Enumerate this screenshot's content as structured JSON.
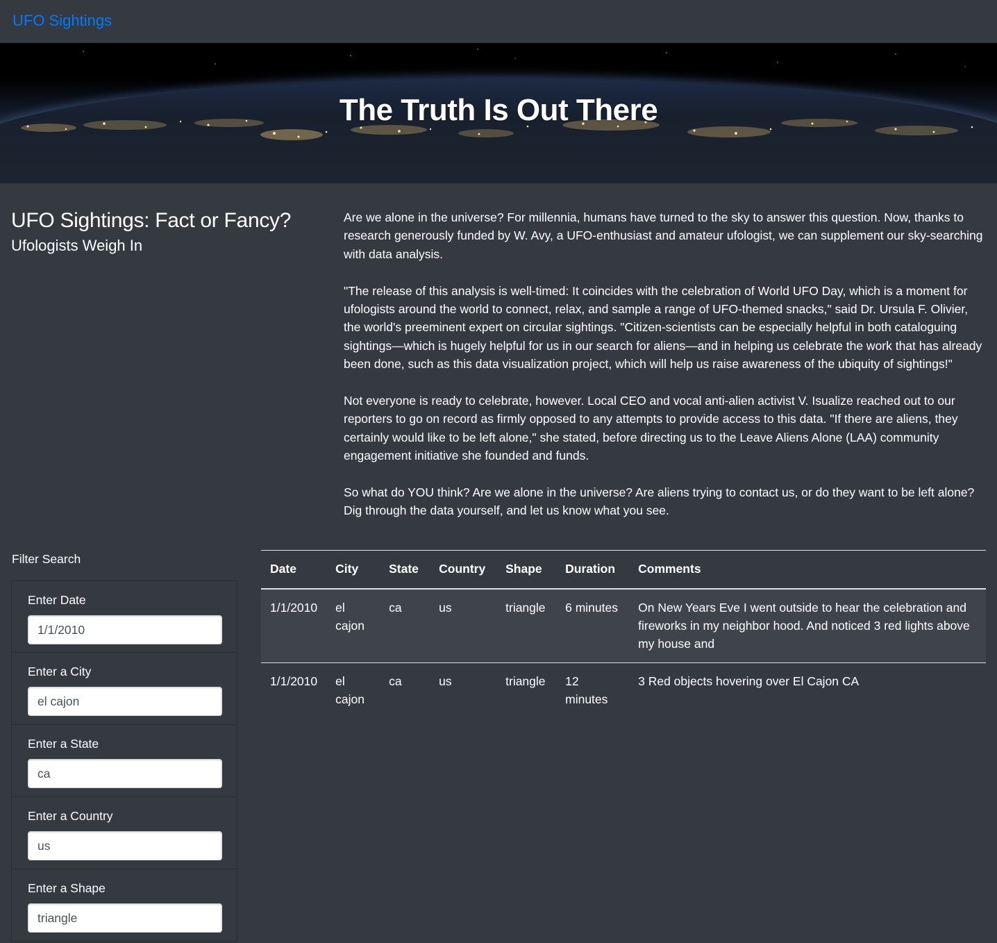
{
  "navbar": {
    "brand": "UFO Sightings"
  },
  "hero": {
    "title": "The Truth Is Out There"
  },
  "intro": {
    "heading": "UFO Sightings: Fact or Fancy?",
    "subheading": "Ufologists Weigh In"
  },
  "article": {
    "paragraphs": [
      "Are we alone in the universe? For millennia, humans have turned to the sky to answer this question. Now, thanks to research generously funded by W. Avy, a UFO-enthusiast and amateur ufologist, we can supplement our sky-searching with data analysis.",
      "\"The release of this analysis is well-timed: It coincides with the celebration of World UFO Day, which is a moment for ufologists around the world to connect, relax, and sample a range of UFO-themed snacks,\" said Dr. Ursula F. Olivier, the world's preeminent expert on circular sightings. \"Citizen-scientists can be especially helpful in both cataloguing sightings—which is hugely helpful for us in our search for aliens—and in helping us celebrate the work that has already been done, such as this data visualization project, which will help us raise awareness of the ubiquity of sightings!\"",
      "Not everyone is ready to celebrate, however. Local CEO and vocal anti-alien activist V. Isualize reached out to our reporters to go on record as firmly opposed to any attempts to provide access to this data. \"If there are aliens, they certainly would like to be left alone,\" she stated, before directing us to the Leave Aliens Alone (LAA) community engagement initiative she founded and funds.",
      "So what do YOU think? Are we alone in the universe? Are aliens trying to contact us, or do they want to be left alone? Dig through the data yourself, and let us know what you see."
    ]
  },
  "filters": {
    "title": "Filter Search",
    "items": [
      {
        "label": "Enter Date",
        "value": "1/1/2010"
      },
      {
        "label": "Enter a City",
        "value": "el cajon"
      },
      {
        "label": "Enter a State",
        "value": "ca"
      },
      {
        "label": "Enter a Country",
        "value": "us"
      },
      {
        "label": "Enter a Shape",
        "value": "triangle"
      }
    ]
  },
  "table": {
    "columns": [
      "Date",
      "City",
      "State",
      "Country",
      "Shape",
      "Duration",
      "Comments"
    ],
    "rows": [
      [
        "1/1/2010",
        "el cajon",
        "ca",
        "us",
        "triangle",
        "6 minutes",
        "On New Years Eve I went outside to hear the celebration and fireworks in my neighbor hood. And noticed 3 red lights above my house and"
      ],
      [
        "1/1/2010",
        "el cajon",
        "ca",
        "us",
        "triangle",
        "12 minutes",
        "3 Red objects hovering over El Cajon CA"
      ]
    ]
  },
  "colors": {
    "background": "#343a40",
    "brand": "#007bff",
    "text": "#ffffff"
  }
}
